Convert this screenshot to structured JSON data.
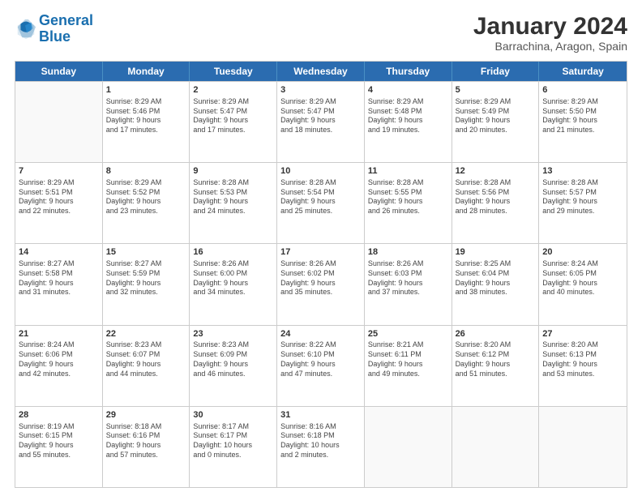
{
  "header": {
    "logo_general": "General",
    "logo_blue": "Blue",
    "main_title": "January 2024",
    "subtitle": "Barrachina, Aragon, Spain"
  },
  "calendar": {
    "days": [
      "Sunday",
      "Monday",
      "Tuesday",
      "Wednesday",
      "Thursday",
      "Friday",
      "Saturday"
    ],
    "rows": [
      [
        {
          "num": "",
          "lines": []
        },
        {
          "num": "1",
          "lines": [
            "Sunrise: 8:29 AM",
            "Sunset: 5:46 PM",
            "Daylight: 9 hours",
            "and 17 minutes."
          ]
        },
        {
          "num": "2",
          "lines": [
            "Sunrise: 8:29 AM",
            "Sunset: 5:47 PM",
            "Daylight: 9 hours",
            "and 17 minutes."
          ]
        },
        {
          "num": "3",
          "lines": [
            "Sunrise: 8:29 AM",
            "Sunset: 5:47 PM",
            "Daylight: 9 hours",
            "and 18 minutes."
          ]
        },
        {
          "num": "4",
          "lines": [
            "Sunrise: 8:29 AM",
            "Sunset: 5:48 PM",
            "Daylight: 9 hours",
            "and 19 minutes."
          ]
        },
        {
          "num": "5",
          "lines": [
            "Sunrise: 8:29 AM",
            "Sunset: 5:49 PM",
            "Daylight: 9 hours",
            "and 20 minutes."
          ]
        },
        {
          "num": "6",
          "lines": [
            "Sunrise: 8:29 AM",
            "Sunset: 5:50 PM",
            "Daylight: 9 hours",
            "and 21 minutes."
          ]
        }
      ],
      [
        {
          "num": "7",
          "lines": [
            "Sunrise: 8:29 AM",
            "Sunset: 5:51 PM",
            "Daylight: 9 hours",
            "and 22 minutes."
          ]
        },
        {
          "num": "8",
          "lines": [
            "Sunrise: 8:29 AM",
            "Sunset: 5:52 PM",
            "Daylight: 9 hours",
            "and 23 minutes."
          ]
        },
        {
          "num": "9",
          "lines": [
            "Sunrise: 8:28 AM",
            "Sunset: 5:53 PM",
            "Daylight: 9 hours",
            "and 24 minutes."
          ]
        },
        {
          "num": "10",
          "lines": [
            "Sunrise: 8:28 AM",
            "Sunset: 5:54 PM",
            "Daylight: 9 hours",
            "and 25 minutes."
          ]
        },
        {
          "num": "11",
          "lines": [
            "Sunrise: 8:28 AM",
            "Sunset: 5:55 PM",
            "Daylight: 9 hours",
            "and 26 minutes."
          ]
        },
        {
          "num": "12",
          "lines": [
            "Sunrise: 8:28 AM",
            "Sunset: 5:56 PM",
            "Daylight: 9 hours",
            "and 28 minutes."
          ]
        },
        {
          "num": "13",
          "lines": [
            "Sunrise: 8:28 AM",
            "Sunset: 5:57 PM",
            "Daylight: 9 hours",
            "and 29 minutes."
          ]
        }
      ],
      [
        {
          "num": "14",
          "lines": [
            "Sunrise: 8:27 AM",
            "Sunset: 5:58 PM",
            "Daylight: 9 hours",
            "and 31 minutes."
          ]
        },
        {
          "num": "15",
          "lines": [
            "Sunrise: 8:27 AM",
            "Sunset: 5:59 PM",
            "Daylight: 9 hours",
            "and 32 minutes."
          ]
        },
        {
          "num": "16",
          "lines": [
            "Sunrise: 8:26 AM",
            "Sunset: 6:00 PM",
            "Daylight: 9 hours",
            "and 34 minutes."
          ]
        },
        {
          "num": "17",
          "lines": [
            "Sunrise: 8:26 AM",
            "Sunset: 6:02 PM",
            "Daylight: 9 hours",
            "and 35 minutes."
          ]
        },
        {
          "num": "18",
          "lines": [
            "Sunrise: 8:26 AM",
            "Sunset: 6:03 PM",
            "Daylight: 9 hours",
            "and 37 minutes."
          ]
        },
        {
          "num": "19",
          "lines": [
            "Sunrise: 8:25 AM",
            "Sunset: 6:04 PM",
            "Daylight: 9 hours",
            "and 38 minutes."
          ]
        },
        {
          "num": "20",
          "lines": [
            "Sunrise: 8:24 AM",
            "Sunset: 6:05 PM",
            "Daylight: 9 hours",
            "and 40 minutes."
          ]
        }
      ],
      [
        {
          "num": "21",
          "lines": [
            "Sunrise: 8:24 AM",
            "Sunset: 6:06 PM",
            "Daylight: 9 hours",
            "and 42 minutes."
          ]
        },
        {
          "num": "22",
          "lines": [
            "Sunrise: 8:23 AM",
            "Sunset: 6:07 PM",
            "Daylight: 9 hours",
            "and 44 minutes."
          ]
        },
        {
          "num": "23",
          "lines": [
            "Sunrise: 8:23 AM",
            "Sunset: 6:09 PM",
            "Daylight: 9 hours",
            "and 46 minutes."
          ]
        },
        {
          "num": "24",
          "lines": [
            "Sunrise: 8:22 AM",
            "Sunset: 6:10 PM",
            "Daylight: 9 hours",
            "and 47 minutes."
          ]
        },
        {
          "num": "25",
          "lines": [
            "Sunrise: 8:21 AM",
            "Sunset: 6:11 PM",
            "Daylight: 9 hours",
            "and 49 minutes."
          ]
        },
        {
          "num": "26",
          "lines": [
            "Sunrise: 8:20 AM",
            "Sunset: 6:12 PM",
            "Daylight: 9 hours",
            "and 51 minutes."
          ]
        },
        {
          "num": "27",
          "lines": [
            "Sunrise: 8:20 AM",
            "Sunset: 6:13 PM",
            "Daylight: 9 hours",
            "and 53 minutes."
          ]
        }
      ],
      [
        {
          "num": "28",
          "lines": [
            "Sunrise: 8:19 AM",
            "Sunset: 6:15 PM",
            "Daylight: 9 hours",
            "and 55 minutes."
          ]
        },
        {
          "num": "29",
          "lines": [
            "Sunrise: 8:18 AM",
            "Sunset: 6:16 PM",
            "Daylight: 9 hours",
            "and 57 minutes."
          ]
        },
        {
          "num": "30",
          "lines": [
            "Sunrise: 8:17 AM",
            "Sunset: 6:17 PM",
            "Daylight: 10 hours",
            "and 0 minutes."
          ]
        },
        {
          "num": "31",
          "lines": [
            "Sunrise: 8:16 AM",
            "Sunset: 6:18 PM",
            "Daylight: 10 hours",
            "and 2 minutes."
          ]
        },
        {
          "num": "",
          "lines": []
        },
        {
          "num": "",
          "lines": []
        },
        {
          "num": "",
          "lines": []
        }
      ]
    ]
  }
}
